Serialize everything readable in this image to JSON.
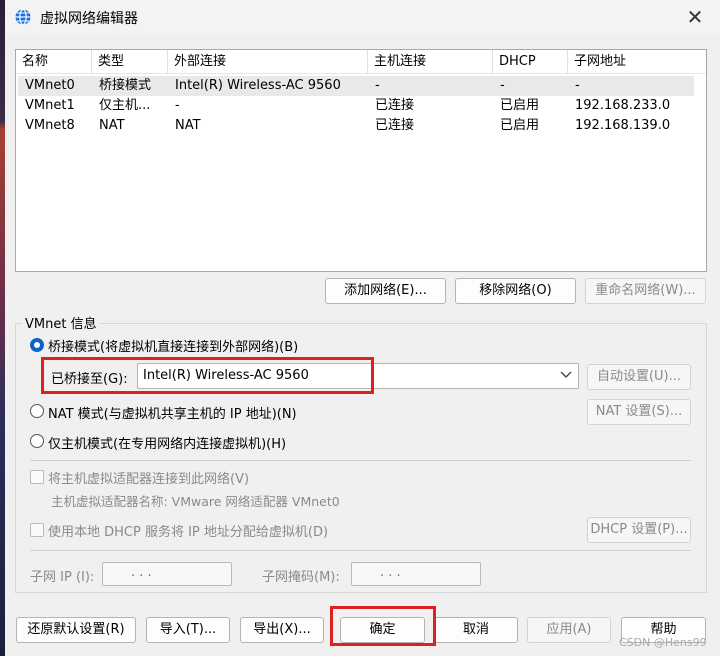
{
  "window": {
    "title": "虚拟网络编辑器",
    "icon": "network-globe-icon",
    "close_glyph": "✕"
  },
  "table": {
    "columns": [
      "名称",
      "类型",
      "外部连接",
      "主机连接",
      "DHCP",
      "子网地址"
    ],
    "rows": [
      {
        "name": "VMnet0",
        "type": "桥接模式",
        "external": "Intel(R) Wireless-AC 9560",
        "host": "-",
        "dhcp": "-",
        "subnet": "-",
        "selected": true
      },
      {
        "name": "VMnet1",
        "type": "仅主机...",
        "external": "-",
        "host": "已连接",
        "dhcp": "已启用",
        "subnet": "192.168.233.0",
        "selected": false
      },
      {
        "name": "VMnet8",
        "type": "NAT",
        "external": "NAT",
        "host": "已连接",
        "dhcp": "已启用",
        "subnet": "192.168.139.0",
        "selected": false
      }
    ]
  },
  "list_buttons": {
    "add": "添加网络(E)...",
    "remove": "移除网络(O)",
    "rename": "重命名网络(W)..."
  },
  "vmnet_info": {
    "group_title": "VMnet 信息",
    "bridged_label": "桥接模式(将虚拟机直接连接到外部网络)(B)",
    "bridged_to_label": "已桥接至(G):",
    "bridged_to_value": "Intel(R) Wireless-AC 9560",
    "auto_button": "自动设置(U)...",
    "nat_label": "NAT 模式(与虚拟机共享主机的 IP 地址)(N)",
    "nat_button": "NAT 设置(S)...",
    "hostonly_label": "仅主机模式(在专用网络内连接虚拟机)(H)",
    "connect_adapter_label": "将主机虚拟适配器连接到此网络(V)",
    "adapter_name_label": "主机虚拟适配器名称: VMware 网络适配器 VMnet0",
    "dhcp_label": "使用本地 DHCP 服务将 IP 地址分配给虚拟机(D)",
    "dhcp_button": "DHCP 设置(P)...",
    "subnet_ip_label": "子网 IP (I):",
    "subnet_mask_label": "子网掩码(M):",
    "ip_dots": ".     .     .",
    "mode": "bridged"
  },
  "footer_buttons": {
    "restore": "还原默认设置(R)",
    "import": "导入(T)...",
    "export": "导出(X)...",
    "ok": "确定",
    "cancel": "取消",
    "apply": "应用(A)",
    "help": "帮助"
  },
  "watermark": "CSDN @Hens99",
  "colors": {
    "highlight_box": "#e02020",
    "radio_selected": "#0a64c8"
  }
}
